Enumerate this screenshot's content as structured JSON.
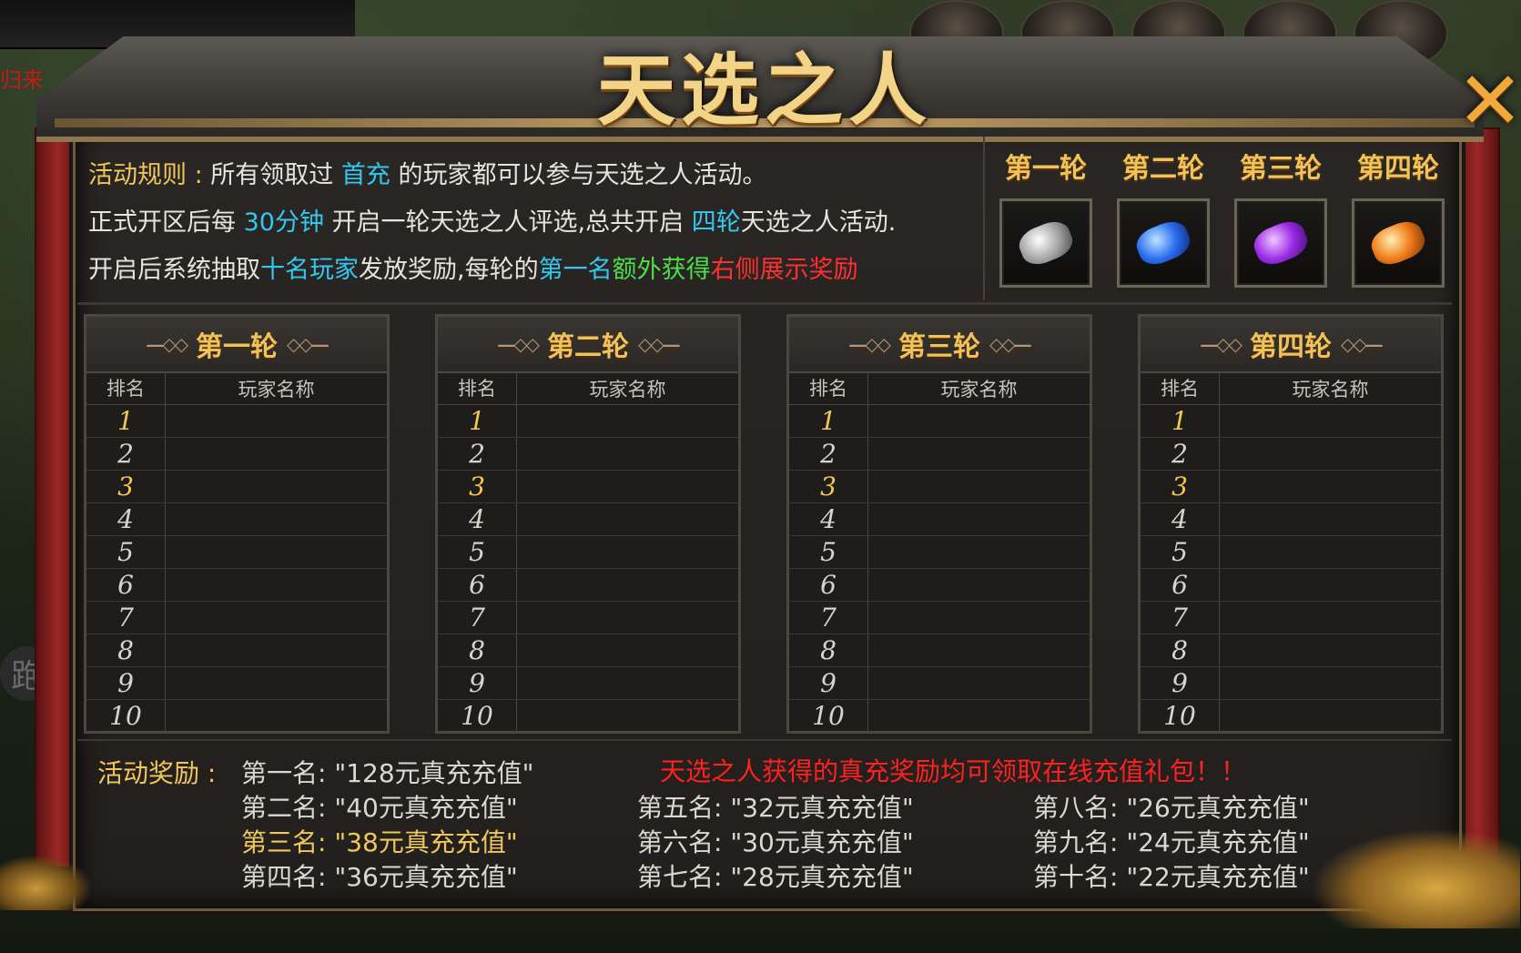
{
  "window": {
    "title": "天选之人",
    "close_icon": "close-icon"
  },
  "side": {
    "left_text": "归来",
    "run_text": "跑"
  },
  "rules": {
    "line1": {
      "label": "活动规则 : ",
      "pre": "所有领取过 ",
      "hl": "首充",
      "post": " 的玩家都可以参与天选之人活动。"
    },
    "line2": {
      "pre": "正式开区后每 ",
      "hl1": "30分钟",
      "mid": " 开启一轮天选之人评选,总共开启 ",
      "hl2": "四轮",
      "post": "天选之人活动."
    },
    "line3": {
      "pre": "开启后系统抽取",
      "hl1": "十名玩家",
      "mid": "发放奖励,每轮的",
      "hl2": "第一名",
      "hl3": "额外获得",
      "hl4": "右侧展示奖励"
    }
  },
  "round_rewards": [
    {
      "label": "第一轮",
      "gem": "silver"
    },
    {
      "label": "第二轮",
      "gem": "blue"
    },
    {
      "label": "第三轮",
      "gem": "purple"
    },
    {
      "label": "第四轮",
      "gem": "orange"
    }
  ],
  "tables": [
    {
      "title": "第一轮",
      "col_rank": "排名",
      "col_name": "玩家名称",
      "ranks": [
        "1",
        "2",
        "3",
        "4",
        "5",
        "6",
        "7",
        "8",
        "9",
        "10"
      ]
    },
    {
      "title": "第二轮",
      "col_rank": "排名",
      "col_name": "玩家名称",
      "ranks": [
        "1",
        "2",
        "3",
        "4",
        "5",
        "6",
        "7",
        "8",
        "9",
        "10"
      ]
    },
    {
      "title": "第三轮",
      "col_rank": "排名",
      "col_name": "玩家名称",
      "ranks": [
        "1",
        "2",
        "3",
        "4",
        "5",
        "6",
        "7",
        "8",
        "9",
        "10"
      ]
    },
    {
      "title": "第四轮",
      "col_rank": "排名",
      "col_name": "玩家名称",
      "ranks": [
        "1",
        "2",
        "3",
        "4",
        "5",
        "6",
        "7",
        "8",
        "9",
        "10"
      ]
    }
  ],
  "rewards": {
    "label": "活动奖励 :",
    "notice": "天选之人获得的真充奖励均可领取在线充值礼包！！",
    "items": [
      {
        "rank": "第一名:",
        "prize": "\"128元真充充值\""
      },
      {
        "rank": "第二名:",
        "prize": "\"40元真充充值\""
      },
      {
        "rank": "第三名:",
        "prize": "\"38元真充充值\""
      },
      {
        "rank": "第四名:",
        "prize": "\"36元真充充值\""
      },
      {
        "rank": "第五名:",
        "prize": "\"32元真充充值\""
      },
      {
        "rank": "第六名:",
        "prize": "\"30元真充充值\""
      },
      {
        "rank": "第七名:",
        "prize": "\"28元真充充值\""
      },
      {
        "rank": "第八名:",
        "prize": "\"26元真充充值\""
      },
      {
        "rank": "第九名:",
        "prize": "\"24元真充充值\""
      },
      {
        "rank": "第十名:",
        "prize": "\"22元真充充值\""
      }
    ]
  },
  "colors": {
    "gold": "#f0c75a",
    "cyan": "#33c8f0",
    "green": "#4be04b",
    "red": "#ff3030"
  }
}
